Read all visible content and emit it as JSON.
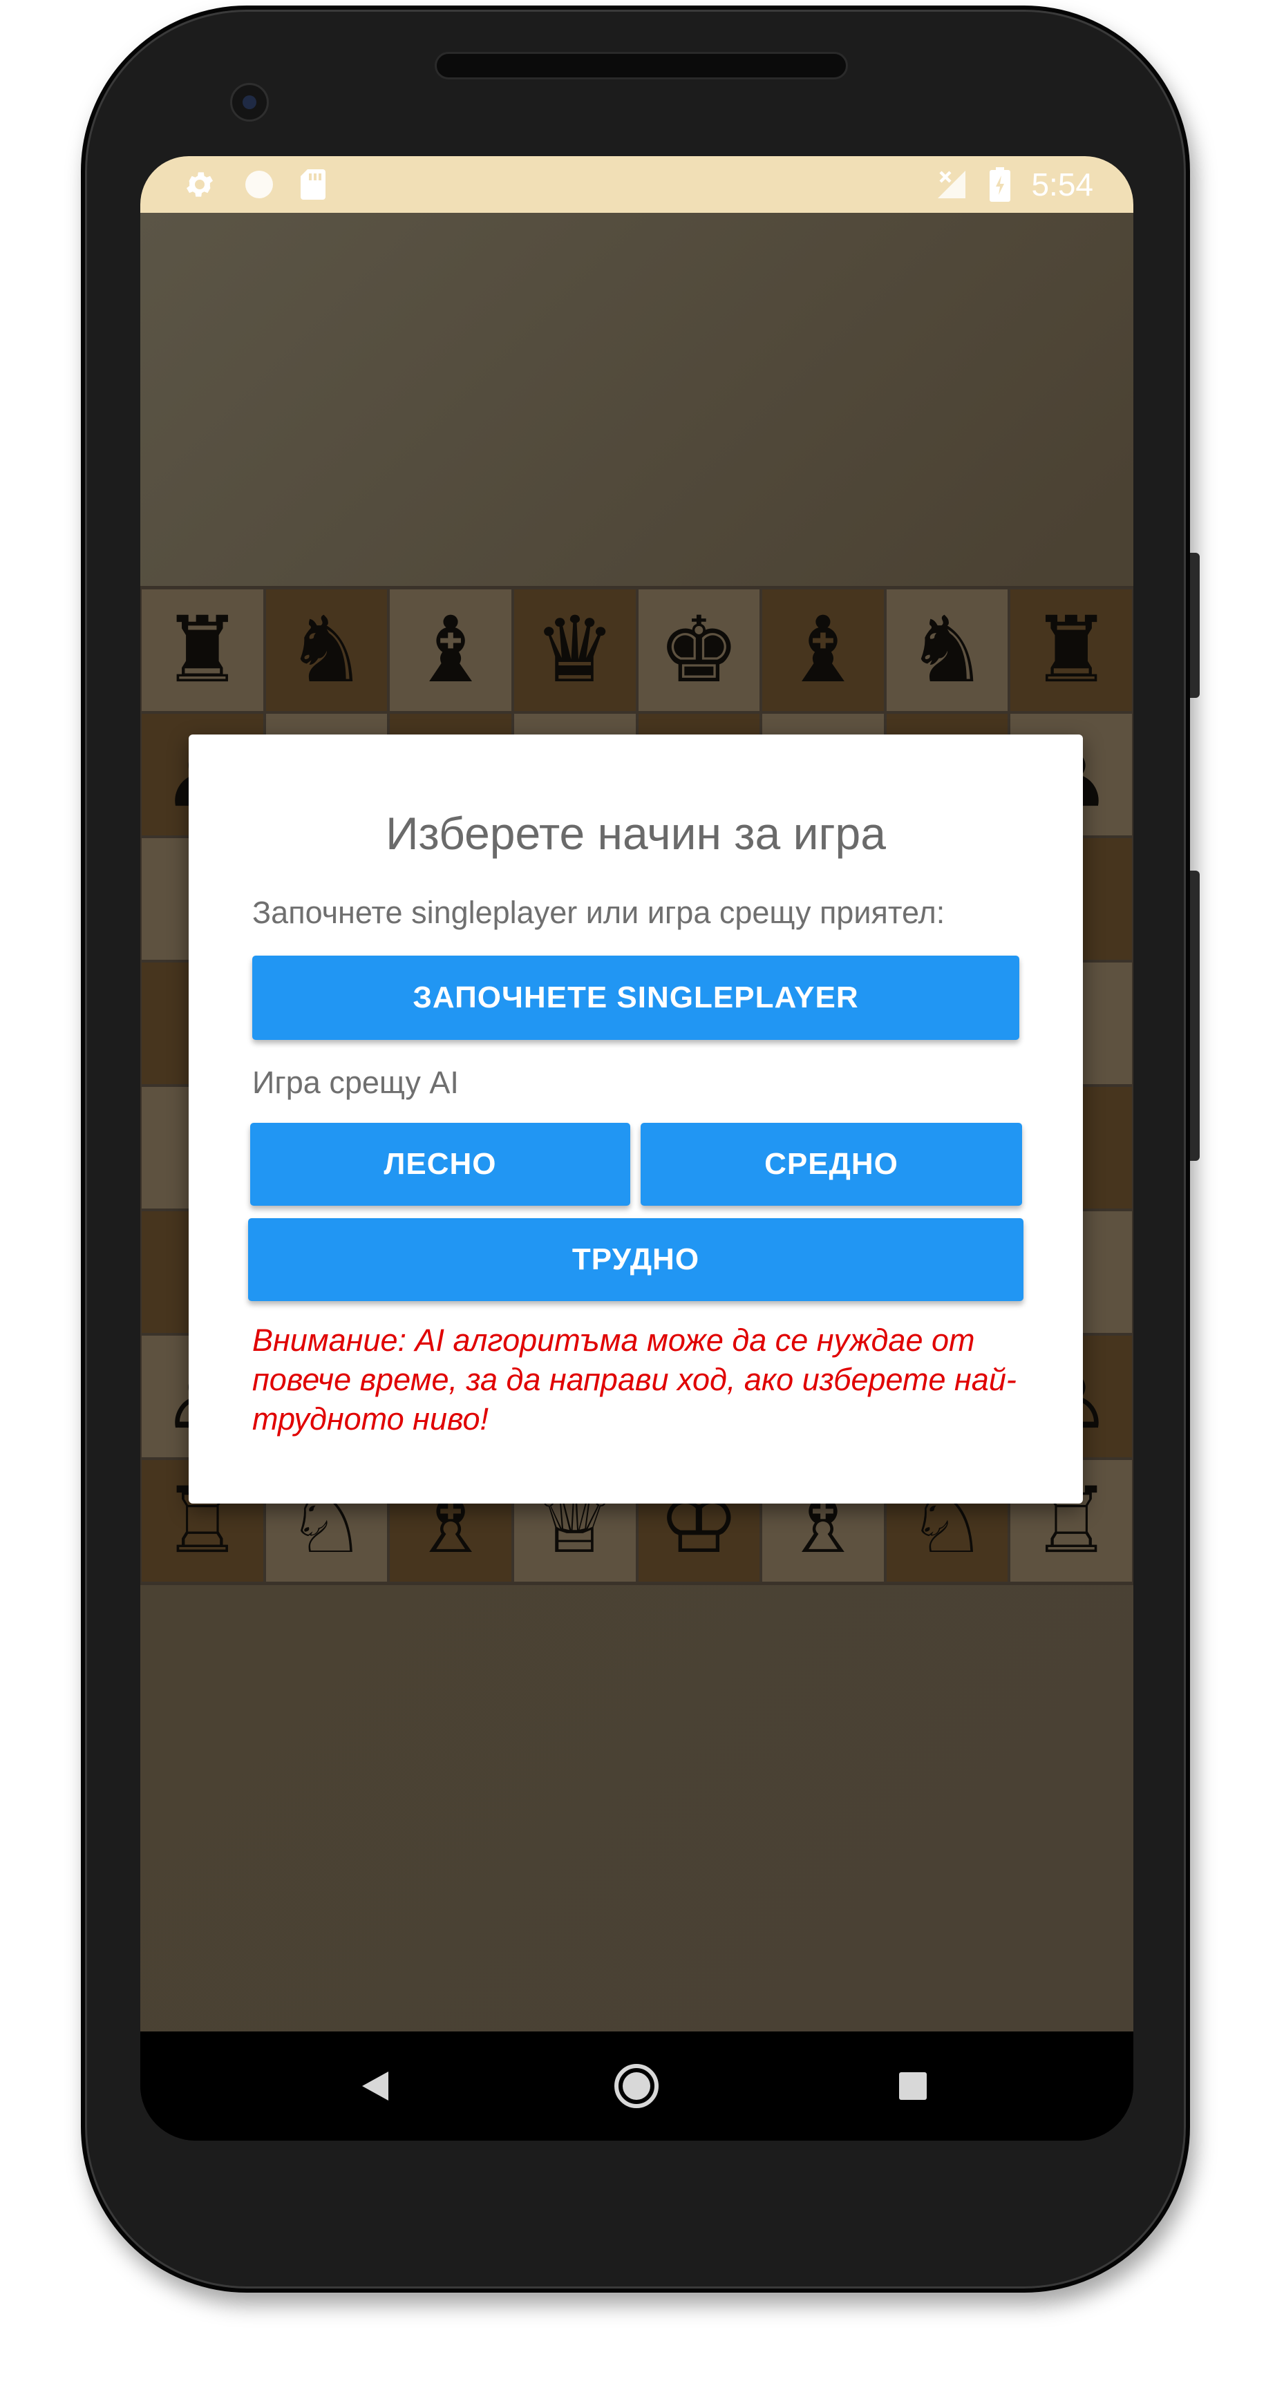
{
  "status_bar": {
    "time": "5:54",
    "icons": [
      "settings-icon",
      "circle-icon",
      "sd-card-icon",
      "no-signal-icon",
      "battery-charging-icon"
    ]
  },
  "board": {
    "squares": [
      [
        "♜",
        "♞",
        "♝",
        "♛",
        "♚",
        "♝",
        "♞",
        "♜"
      ],
      [
        "♟",
        "",
        "",
        "",
        "",
        "",
        "",
        "♟"
      ],
      [
        "",
        "",
        "",
        "",
        "",
        "",
        "",
        ""
      ],
      [
        "",
        "",
        "",
        "",
        "",
        "",
        "",
        ""
      ],
      [
        "",
        "",
        "",
        "",
        "",
        "",
        "",
        ""
      ],
      [
        "",
        "",
        "",
        "",
        "",
        "",
        "",
        ""
      ],
      [
        "♙",
        "",
        "",
        "",
        "",
        "",
        "",
        "♙"
      ],
      [
        "♖",
        "♘",
        "♗",
        "♕",
        "♔",
        "♗",
        "♘",
        "♖"
      ]
    ]
  },
  "dialog": {
    "title": "Изберете начин за игра",
    "intro_text": "Започнете singleplayer или игра срещу приятел:",
    "singleplayer_label": "ЗАПОЧНЕТЕ SINGLEPLAYER",
    "ai_section_label": "Игра срещу AI",
    "easy_label": "ЛЕСНО",
    "medium_label": "СРЕДНО",
    "hard_label": "ТРУДНО",
    "warning_text": "Внимание: AI алгоритъма може да се нуждае от повече време, за да направи ход, ако изберете най-трудното ниво!"
  },
  "nav_bar": {
    "icons": [
      "back-icon",
      "home-icon",
      "recents-icon"
    ]
  },
  "colors": {
    "accent": "#2196f3",
    "warning": "#e00000",
    "status_bar": "#f1dfb6",
    "square_light": "#5e5240",
    "square_dark": "#47351e"
  }
}
